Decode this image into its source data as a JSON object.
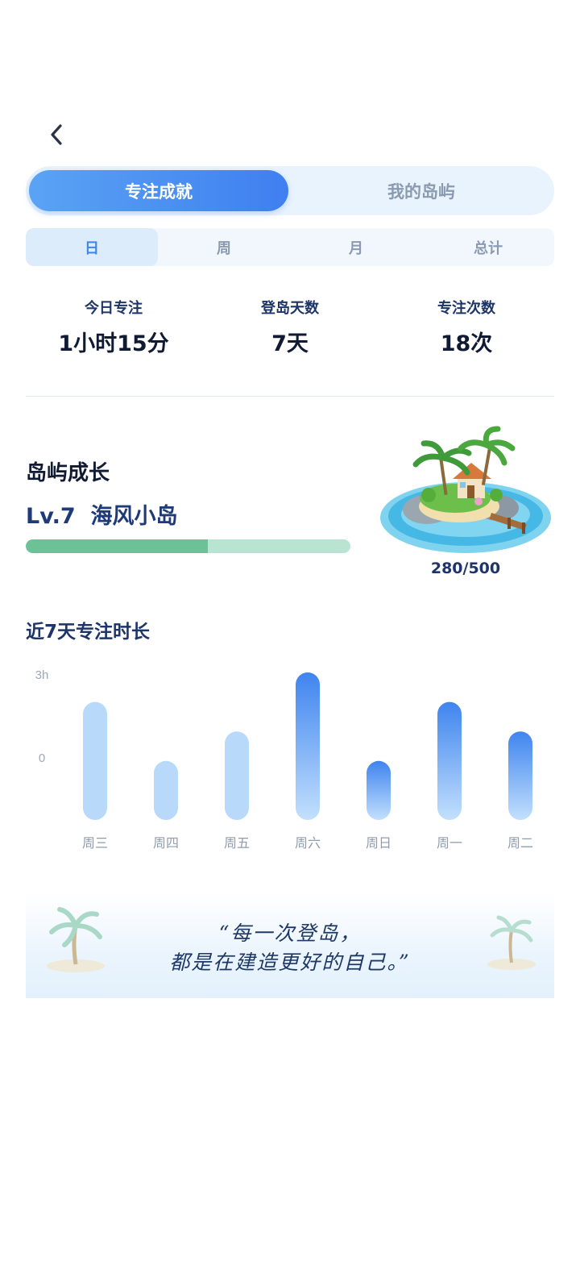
{
  "tabs": {
    "achievement": "专注成就",
    "my_island": "我的岛屿",
    "active": "achievement"
  },
  "period_tabs": [
    {
      "label": "日",
      "active": true
    },
    {
      "label": "周",
      "active": false
    },
    {
      "label": "月",
      "active": false
    },
    {
      "label": "总计",
      "active": false
    }
  ],
  "stats": [
    {
      "label": "今日专注",
      "value": "1小时15分"
    },
    {
      "label": "登岛天数",
      "value": "7天"
    },
    {
      "label": "专注次数",
      "value": "18次"
    }
  ],
  "growth": {
    "title": "岛屿成长",
    "level": "Lv.7  海风小岛",
    "progress_text": "280/500",
    "progress_fraction": 0.56
  },
  "chart": {
    "title": "近7天专注时长"
  },
  "chart_data": {
    "type": "bar",
    "y_ticks": [
      "3h",
      "0"
    ],
    "categories": [
      "周三",
      "周四",
      "周五",
      "周六",
      "周日",
      "周一",
      "周二"
    ],
    "values": [
      2.4,
      1.2,
      1.8,
      3.0,
      1.2,
      2.4,
      1.8
    ],
    "highlighted": [
      false,
      false,
      false,
      true,
      true,
      true,
      true
    ],
    "colors": {
      "muted": "#b9d9fb",
      "accent_top": "#3f84ee",
      "accent_bottom": "#c3e0fd"
    }
  },
  "quote": {
    "line1": "“每一次登岛，",
    "line2": "都是在建造更好的自己。”"
  },
  "colors": {
    "primary": "#3f7ff0",
    "progress": "#6cc296",
    "progress_track": "#b9e4d1"
  }
}
